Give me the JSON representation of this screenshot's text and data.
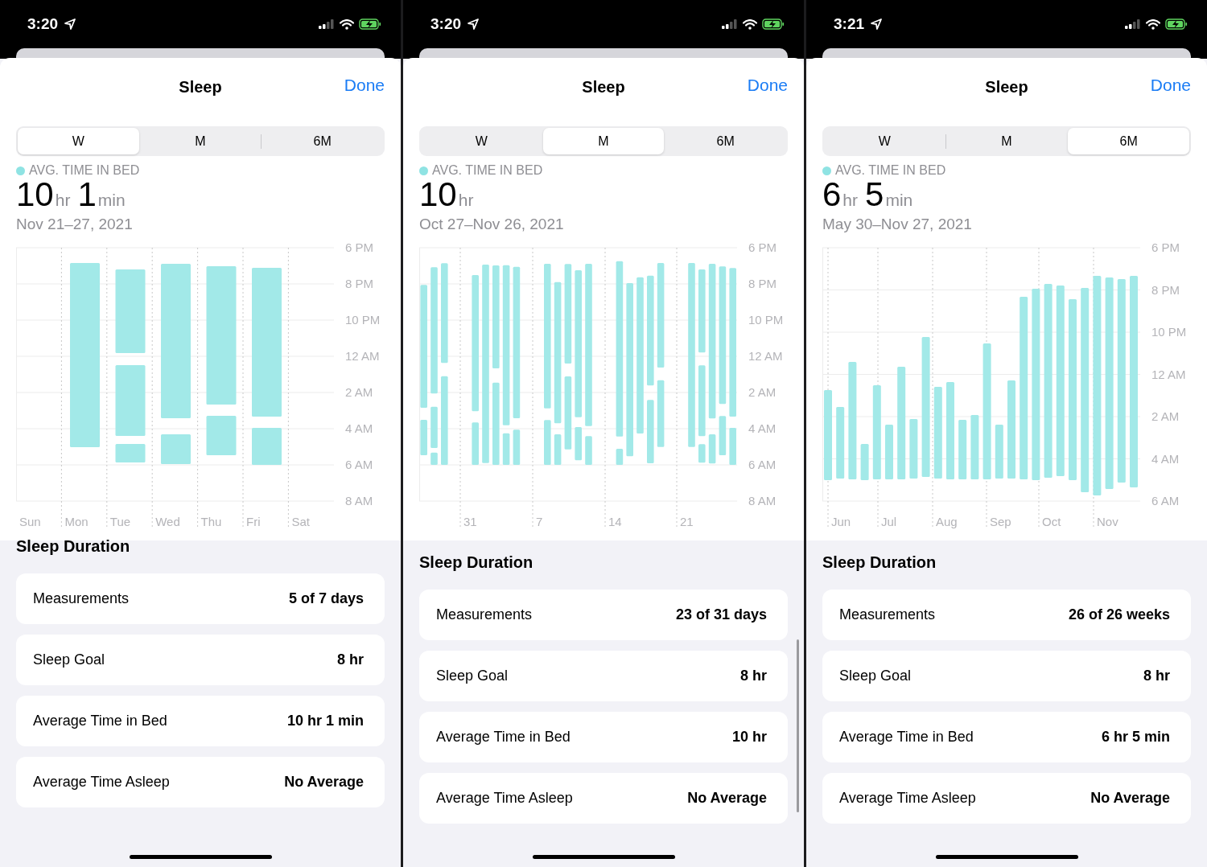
{
  "panels": [
    {
      "status_bar": {
        "time": "3:20"
      },
      "title": "Sleep",
      "done": "Done",
      "ranges": [
        {
          "label": "W",
          "selected": true
        },
        {
          "label": "M",
          "selected": false
        },
        {
          "label": "6M",
          "selected": false
        }
      ],
      "legend": "AVG. TIME IN BED",
      "average": [
        {
          "number": "10",
          "unit": "hr"
        },
        {
          "number": "1",
          "unit": "min"
        }
      ],
      "date_range": "Nov 21–27, 2021",
      "chart": {
        "y_labels": [
          "6 PM",
          "8 PM",
          "10 PM",
          "12 AM",
          "2 AM",
          "4 AM",
          "6 AM",
          "8 AM"
        ],
        "x_labels": [
          "Sun",
          "Mon",
          "Tue",
          "Wed",
          "Thu",
          "Fri",
          "Sat"
        ]
      },
      "section_title": "Sleep Duration",
      "rows": [
        {
          "label": "Measurements",
          "value": "5 of 7 days"
        },
        {
          "label": "Sleep Goal",
          "value": "8 hr"
        },
        {
          "label": "Average Time in Bed",
          "value": "10 hr 1 min"
        },
        {
          "label": "Average Time Asleep",
          "value": "No Average"
        }
      ]
    },
    {
      "status_bar": {
        "time": "3:20"
      },
      "title": "Sleep",
      "done": "Done",
      "ranges": [
        {
          "label": "W",
          "selected": false
        },
        {
          "label": "M",
          "selected": true
        },
        {
          "label": "6M",
          "selected": false
        }
      ],
      "legend": "AVG. TIME IN BED",
      "average": [
        {
          "number": "10",
          "unit": "hr"
        }
      ],
      "date_range": "Oct 27–Nov 26, 2021",
      "chart": {
        "y_labels": [
          "6 PM",
          "8 PM",
          "10 PM",
          "12 AM",
          "2 AM",
          "4 AM",
          "6 AM",
          "8 AM"
        ],
        "x_labels": [
          "31",
          "7",
          "14",
          "21"
        ]
      },
      "section_title": "Sleep Duration",
      "rows": [
        {
          "label": "Measurements",
          "value": "23 of 31 days"
        },
        {
          "label": "Sleep Goal",
          "value": "8 hr"
        },
        {
          "label": "Average Time in Bed",
          "value": "10 hr"
        },
        {
          "label": "Average Time Asleep",
          "value": "No Average"
        }
      ]
    },
    {
      "status_bar": {
        "time": "3:21"
      },
      "title": "Sleep",
      "done": "Done",
      "ranges": [
        {
          "label": "W",
          "selected": false
        },
        {
          "label": "M",
          "selected": false
        },
        {
          "label": "6M",
          "selected": true
        }
      ],
      "legend": "AVG. TIME IN BED",
      "average": [
        {
          "number": "6",
          "unit": "hr"
        },
        {
          "number": "5",
          "unit": "min"
        }
      ],
      "date_range": "May 30–Nov 27, 2021",
      "chart": {
        "y_labels": [
          "6 PM",
          "8 PM",
          "10 PM",
          "12 AM",
          "2 AM",
          "4 AM",
          "6 AM"
        ],
        "x_labels": [
          "Jun",
          "Jul",
          "Aug",
          "Sep",
          "Oct",
          "Nov"
        ]
      },
      "section_title": "Sleep Duration",
      "rows": [
        {
          "label": "Measurements",
          "value": "26 of 26 weeks"
        },
        {
          "label": "Sleep Goal",
          "value": "8 hr"
        },
        {
          "label": "Average Time in Bed",
          "value": "6 hr 5 min"
        },
        {
          "label": "Average Time Asleep",
          "value": "No Average"
        }
      ]
    }
  ]
}
